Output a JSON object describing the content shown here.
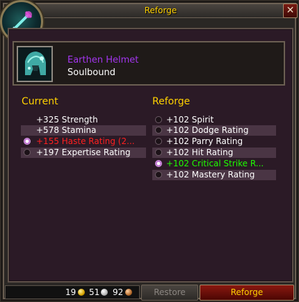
{
  "window": {
    "title": "Reforge",
    "close_label": "✕"
  },
  "item": {
    "name": "Earthen Helmet",
    "binding": "Soulbound",
    "name_color": "#a335ee"
  },
  "current": {
    "heading": "Current",
    "stats": [
      {
        "text": "+325 Strength",
        "radio": false,
        "selected": false,
        "color": "#ffffff"
      },
      {
        "text": "+578 Stamina",
        "radio": false,
        "selected": false,
        "color": "#ffffff"
      },
      {
        "text": "+155 Haste Rating (2...",
        "radio": true,
        "selected": true,
        "color": "#ff2020"
      },
      {
        "text": "+197 Expertise Rating",
        "radio": true,
        "selected": false,
        "color": "#ffffff"
      }
    ]
  },
  "reforge": {
    "heading": "Reforge",
    "stats": [
      {
        "text": "+102 Spirit",
        "selected": false,
        "color": "#ffffff"
      },
      {
        "text": "+102 Dodge Rating",
        "selected": false,
        "color": "#ffffff"
      },
      {
        "text": "+102 Parry Rating",
        "selected": false,
        "color": "#ffffff"
      },
      {
        "text": "+102 Hit Rating",
        "selected": false,
        "color": "#ffffff"
      },
      {
        "text": "+102 Critical Strike R...",
        "selected": true,
        "color": "#1eff00"
      },
      {
        "text": "+102 Mastery Rating",
        "selected": false,
        "color": "#ffffff"
      }
    ]
  },
  "money": {
    "gold": "19",
    "silver": "51",
    "copper": "92"
  },
  "buttons": {
    "restore": "Restore",
    "reforge": "Reforge"
  }
}
